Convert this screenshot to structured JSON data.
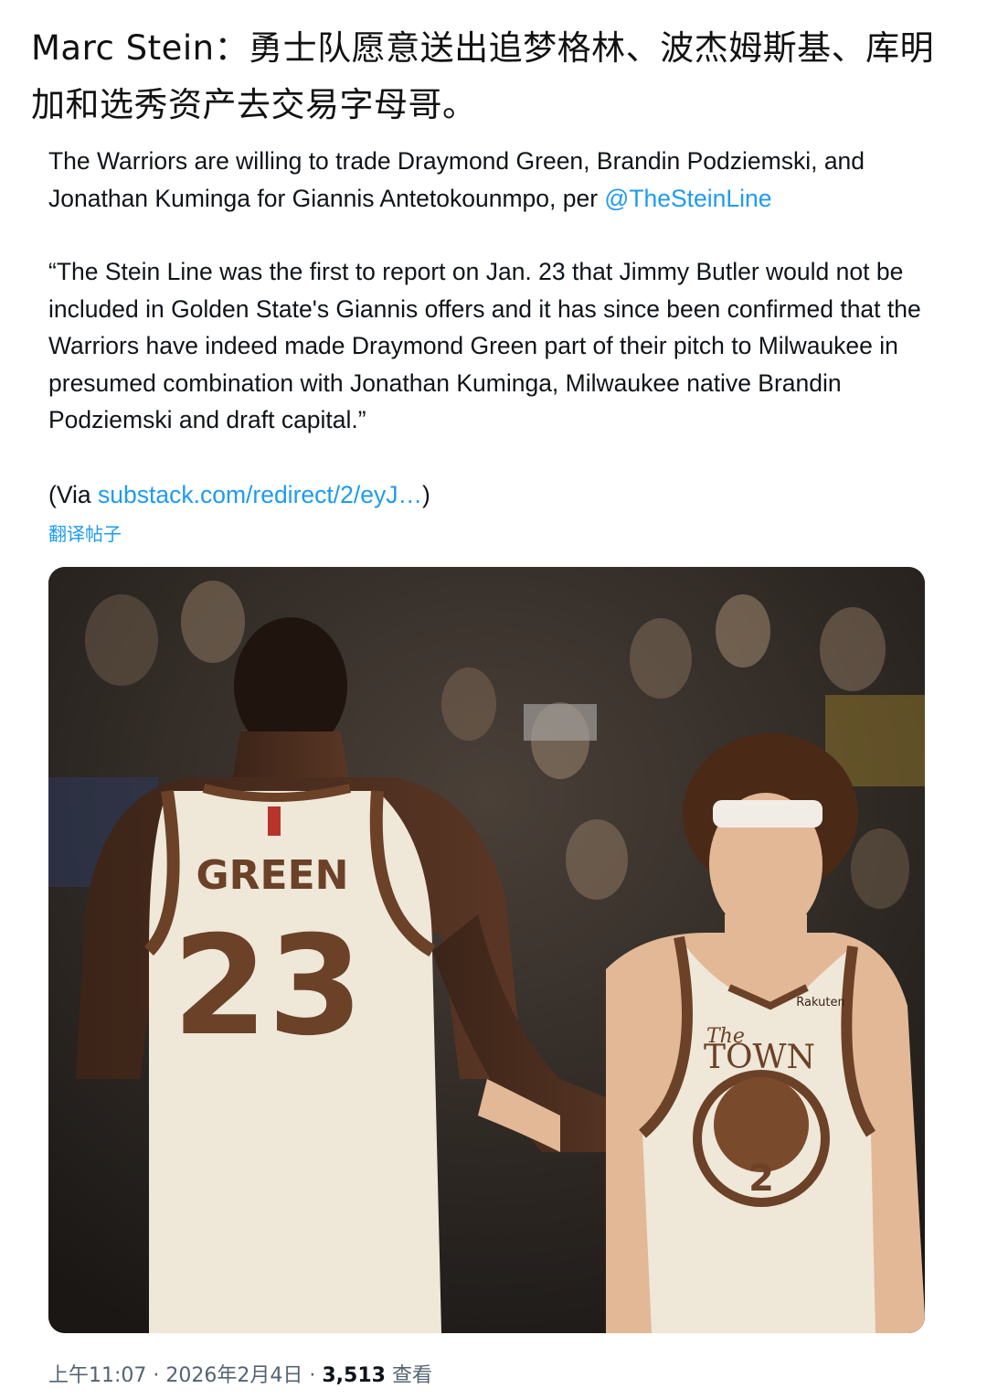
{
  "headline": "Marc Stein：勇士队愿意送出追梦格林、波杰姆斯基、库明加和选秀资产去交易字母哥。",
  "tweet": {
    "p1_text": "The Warriors are willing to trade Draymond Green, Brandin Podziemski, and Jonathan Kuminga for Giannis Antetokounmpo, per ",
    "p1_mention": "@TheSteinLine",
    "p2": "“The Stein Line was the first to report on Jan. 23 that Jimmy Butler would not be included in Golden State's Giannis offers and it has since been confirmed that the Warriors have indeed made Draymond Green part of their pitch to Milwaukee in presumed combination with Jonathan Kuminga, Milwaukee native Brandin Podziemski and draft capital.”",
    "p3_prefix": "(Via ",
    "p3_link": "substack.com/redirect/2/eyJ…",
    "p3_suffix": ")"
  },
  "translate_label": "翻译帖子",
  "photo": {
    "left_player": {
      "name": "GREEN",
      "number": "23"
    },
    "right_player": {
      "number": "2",
      "sponsor": "Rakuten",
      "jersey_the": "The",
      "jersey_word": "TOWN"
    }
  },
  "meta": {
    "time": "上午11:07",
    "sep1": " · ",
    "date": "2026年2月4日",
    "sep2": " · ",
    "views": "3,513",
    "views_label": " 查看"
  },
  "colors": {
    "link": "#1d9bf0",
    "jersey_cream": "#efe7d8",
    "jersey_brown": "#6b4127",
    "meta_gray": "#536471"
  }
}
